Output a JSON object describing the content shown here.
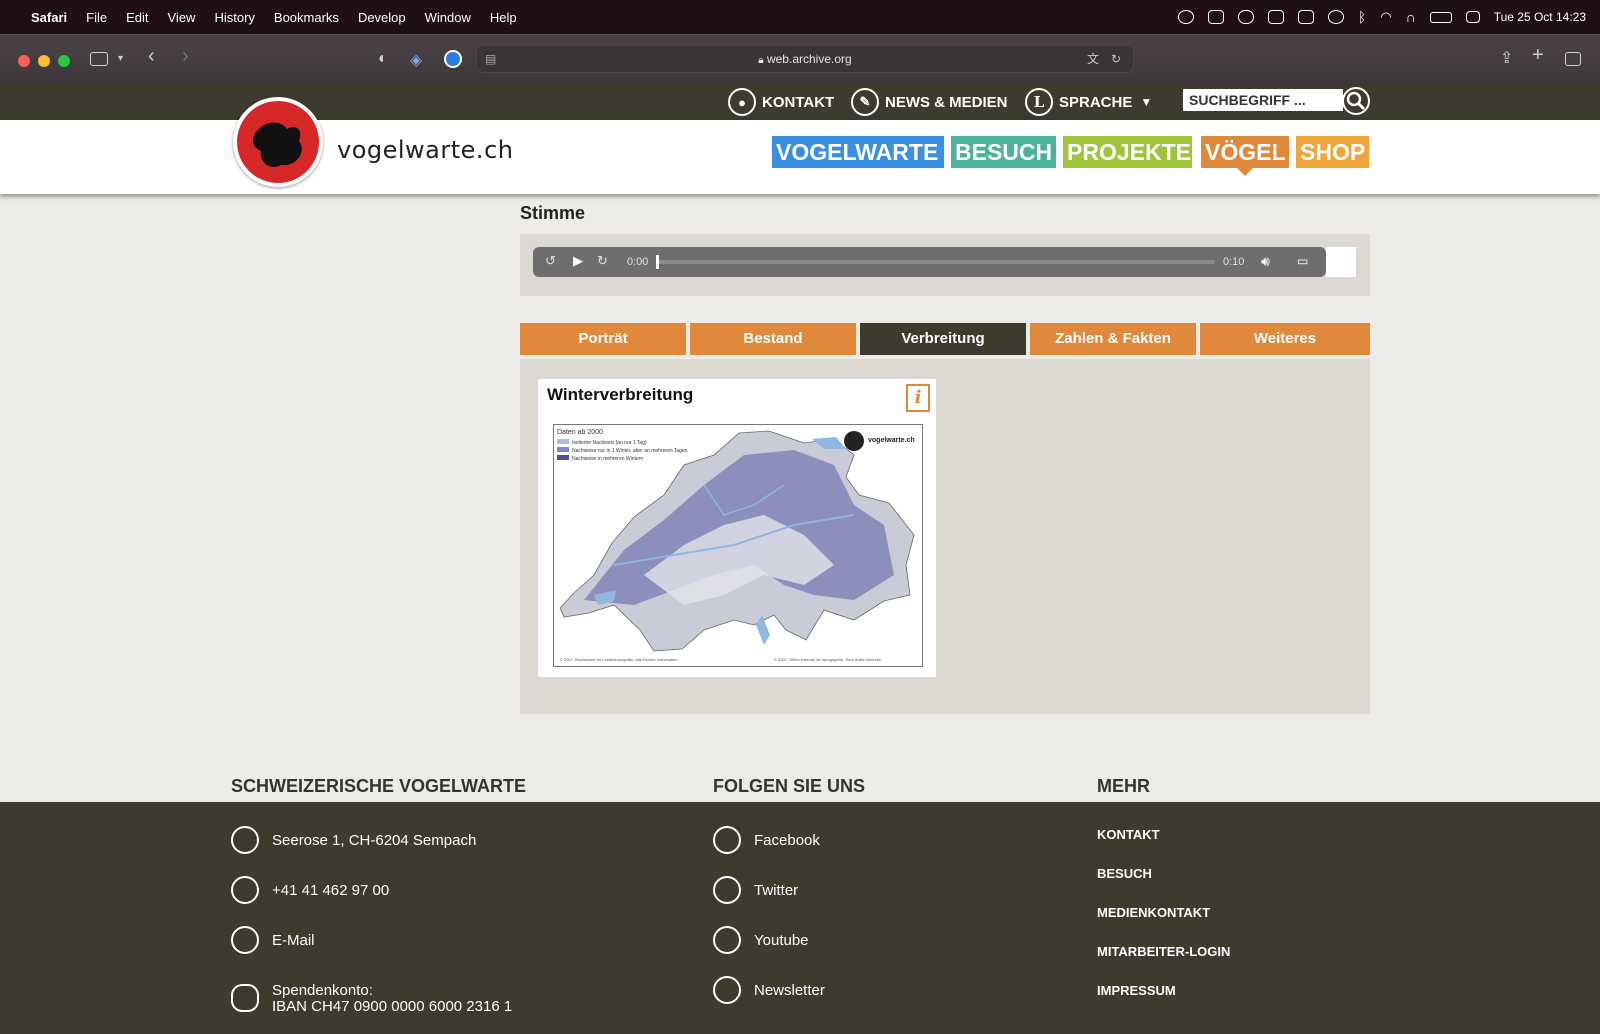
{
  "menubar": {
    "app": "Safari",
    "items": [
      "File",
      "Edit",
      "View",
      "History",
      "Bookmarks",
      "Develop",
      "Window",
      "Help"
    ],
    "clock": "Tue 25 Oct  14:23"
  },
  "browser": {
    "url": "web.archive.org"
  },
  "site": {
    "topnav": {
      "kontakt": "KONTAKT",
      "news": "NEWS & MEDIEN",
      "sprache": "SPRACHE",
      "search_placeholder": "SUCHBEGRIFF ..."
    },
    "logo_text": "vogelwarte.ch",
    "mainnav": [
      {
        "label": "VOGELWARTE",
        "color": "#3b8fe3"
      },
      {
        "label": "BESUCH",
        "color": "#4bb39b"
      },
      {
        "label": "PROJEKTE",
        "color": "#9fc33a"
      },
      {
        "label": "VÖGEL",
        "color": "#e1893a"
      },
      {
        "label": "SHOP",
        "color": "#f0a43a"
      }
    ]
  },
  "content": {
    "section_title": "Stimme",
    "player": {
      "current_time": "0:00",
      "duration": "0:10",
      "progress": 0
    },
    "tabs": [
      "Porträt",
      "Bestand",
      "Verbreitung",
      "Zahlen & Fakten",
      "Weiteres"
    ],
    "active_tab": "Verbreitung",
    "map": {
      "title": "Winterverbreitung",
      "legend_title": "Daten ab 2000",
      "legend": [
        "Isolierter Nachweis (an nur 1 Tag)",
        "Nachweise nur in 1 Winter, aber an mehreren Tagen",
        "Nachweise in mehreren Wintern"
      ],
      "brand": "vogelwarte.ch",
      "credit_left": "© 2007, Bundesamt für Landestopografie. Alle Rechte vorbehalten",
      "credit_right": "© 2007, Office fédérale de topographie. Tous droits réservés"
    }
  },
  "footer": {
    "col1_title": "SCHWEIZERISCHE VOGELWARTE",
    "address": "Seerose 1, CH-6204 Sempach",
    "phone": "+41 41 462 97 00",
    "email": "E-Mail",
    "donation_label": "Spendenkonto:",
    "iban": "IBAN CH47 0900 0000 6000 2316 1",
    "col2_title": "FOLGEN SIE UNS",
    "social": [
      "Facebook",
      "Twitter",
      "Youtube",
      "Newsletter"
    ],
    "col3_title": "MEHR",
    "links": [
      "KONTAKT",
      "BESUCH",
      "MEDIENKONTAKT",
      "MITARBEITER-LOGIN",
      "IMPRESSUM"
    ]
  }
}
